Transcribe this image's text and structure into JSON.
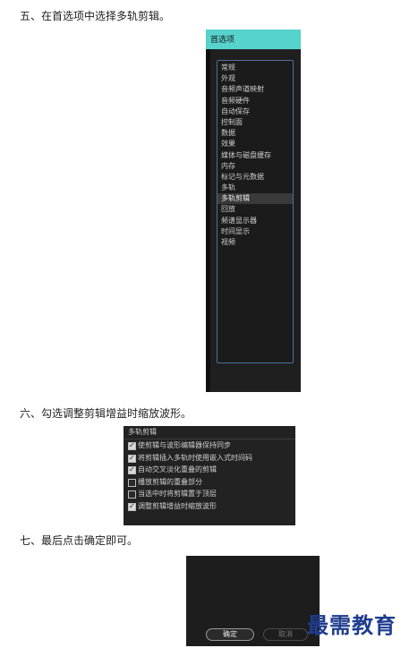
{
  "steps": {
    "step5": "五、在首选项中选择多轨剪辑。",
    "step6": "六、勾选调整剪辑增益时缩放波形。",
    "step7": "七、最后点击确定即可。"
  },
  "preferences": {
    "title": "首选项",
    "items": [
      "常规",
      "外观",
      "音频声道映射",
      "音频硬件",
      "自动保存",
      "控制面",
      "数据",
      "效果",
      "媒体与磁盘缓存",
      "内存",
      "标记与元数据",
      "多轨",
      "多轨剪辑",
      "回放",
      "频谱显示器",
      "时间显示",
      "视频"
    ],
    "selected_index": 12
  },
  "multitrack": {
    "header": "多轨剪辑",
    "options": [
      {
        "label": "使剪辑与波形编辑器保持同步",
        "checked": true
      },
      {
        "label": "将剪辑插入多轨时使用嵌入式时间码",
        "checked": true
      },
      {
        "label": "自动交叉淡化重叠的剪辑",
        "checked": true
      },
      {
        "label": "播放剪辑的重叠部分",
        "checked": false
      },
      {
        "label": "当选中时将剪辑置于顶层",
        "checked": false
      },
      {
        "label": "调整剪辑增益时缩放波形",
        "checked": true
      }
    ]
  },
  "dialog": {
    "ok_label": "确定",
    "cancel_label": "取消"
  },
  "watermark": "最需教育"
}
